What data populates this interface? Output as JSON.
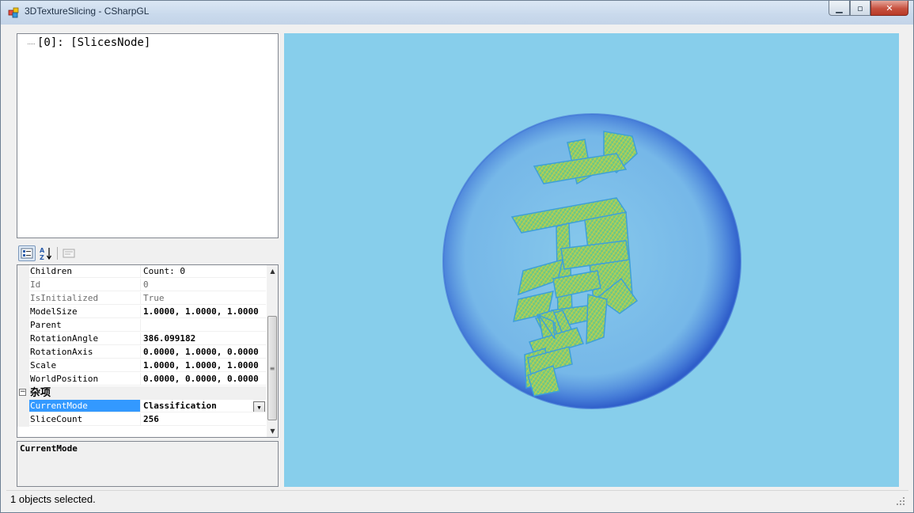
{
  "window": {
    "title": "3DTextureSlicing - CSharpGL",
    "minimize_glyph": "▁",
    "maximize_glyph": "▫",
    "close_glyph": "✕"
  },
  "tree": {
    "nodes": [
      {
        "label": "[0]: [SlicesNode]"
      }
    ]
  },
  "property_grid": {
    "toolbar": {
      "categorized_icon": "categorized-icon",
      "alphabetical_icon": "alphabetical-icon",
      "property_pages_icon": "property-pages-icon"
    },
    "rows": [
      {
        "name": "Children",
        "value": "Count: 0"
      },
      {
        "name": "Id",
        "value": "0"
      },
      {
        "name": "IsInitialized",
        "value": "True"
      },
      {
        "name": "ModelSize",
        "value": "1.0000, 1.0000, 1.0000"
      },
      {
        "name": "Parent",
        "value": ""
      },
      {
        "name": "RotationAngle",
        "value": "386.099182"
      },
      {
        "name": "RotationAxis",
        "value": "0.0000, 1.0000, 0.0000"
      },
      {
        "name": "Scale",
        "value": "1.0000, 1.0000, 1.0000"
      },
      {
        "name": "WorldPosition",
        "value": "0.0000, 0.0000, 0.0000"
      }
    ],
    "category": {
      "toggle": "−",
      "label": "杂项"
    },
    "misc_rows": [
      {
        "name": "CurrentMode",
        "value": "Classification"
      },
      {
        "name": "SliceCount",
        "value": "256"
      }
    ],
    "description_title": "CurrentMode"
  },
  "canvas": {
    "background": "#87ceeb",
    "scene": "volume-rendered sphere with character slices"
  },
  "status": {
    "text": "1 objects selected."
  },
  "colors": {
    "selection": "#3399ff",
    "readonly_text": "#6d6d6d"
  }
}
